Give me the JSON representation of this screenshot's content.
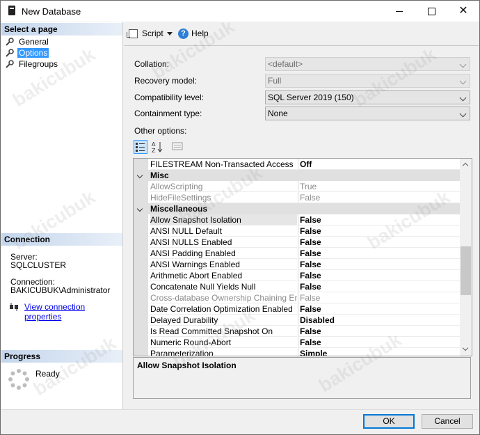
{
  "window": {
    "title": "New Database"
  },
  "left": {
    "select_page_header": "Select a page",
    "pages": [
      {
        "label": "General"
      },
      {
        "label": "Options"
      },
      {
        "label": "Filegroups"
      }
    ],
    "connection_header": "Connection",
    "server_label": "Server:",
    "server_value": "SQLCLUSTER",
    "connection_label": "Connection:",
    "connection_value": "BAKICUBUK\\Administrator",
    "view_connection_link": "View connection properties",
    "progress_header": "Progress",
    "progress_status": "Ready"
  },
  "toolbar": {
    "script_label": "Script",
    "help_label": "Help"
  },
  "form": {
    "collation_label": "Collation:",
    "collation_value": "<default>",
    "recovery_label": "Recovery model:",
    "recovery_value": "Full",
    "compat_label": "Compatibility level:",
    "compat_value": "SQL Server 2019 (150)",
    "containment_label": "Containment type:",
    "containment_value": "None",
    "other_options_label": "Other options:"
  },
  "grid": {
    "rows": [
      {
        "name": "FILESTREAM Non-Transacted Access",
        "value": "Off"
      },
      {
        "category": "Misc"
      },
      {
        "name": "AllowScripting",
        "value": "True",
        "dim": true
      },
      {
        "name": "HideFileSettings",
        "value": "False",
        "dim": true
      },
      {
        "category": "Miscellaneous"
      },
      {
        "name": "Allow Snapshot Isolation",
        "value": "False",
        "selected": true
      },
      {
        "name": "ANSI NULL Default",
        "value": "False"
      },
      {
        "name": "ANSI NULLS Enabled",
        "value": "False"
      },
      {
        "name": "ANSI Padding Enabled",
        "value": "False"
      },
      {
        "name": "ANSI Warnings Enabled",
        "value": "False"
      },
      {
        "name": "Arithmetic Abort Enabled",
        "value": "False"
      },
      {
        "name": "Concatenate Null Yields Null",
        "value": "False"
      },
      {
        "name": "Cross-database Ownership Chaining Enabled",
        "value": "False",
        "dim": true
      },
      {
        "name": "Date Correlation Optimization Enabled",
        "value": "False"
      },
      {
        "name": "Delayed Durability",
        "value": "Disabled"
      },
      {
        "name": "Is Read Committed Snapshot On",
        "value": "False"
      },
      {
        "name": "Numeric Round-Abort",
        "value": "False"
      },
      {
        "name": "Parameterization",
        "value": "Simple"
      }
    ],
    "description_title": "Allow Snapshot Isolation"
  },
  "buttons": {
    "ok": "OK",
    "cancel": "Cancel"
  },
  "watermark": "bakicubuk"
}
